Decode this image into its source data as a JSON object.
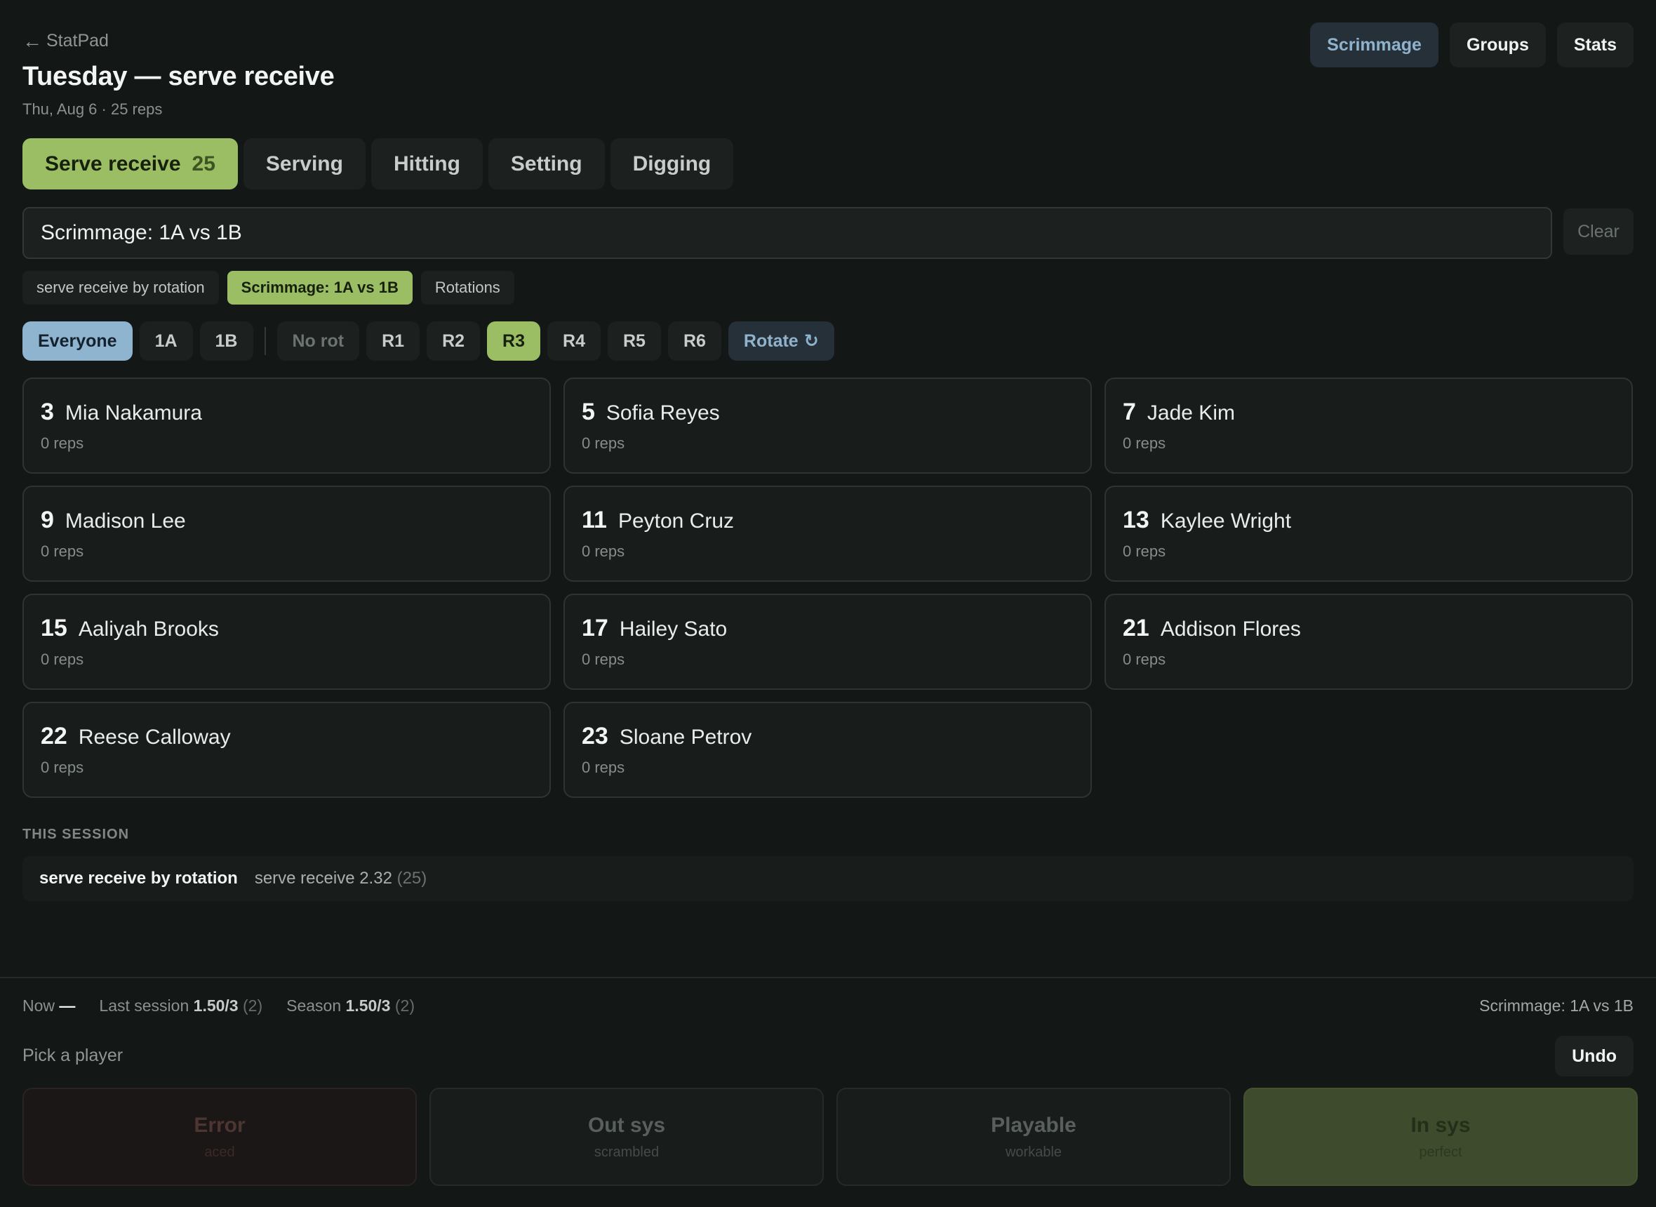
{
  "header": {
    "back_arrow": "←",
    "back_label": "StatPad",
    "title": "Tuesday — serve receive",
    "subtitle": "Thu, Aug 6 · 25 reps"
  },
  "topnav": [
    "Scrimmage",
    "Groups",
    "Stats"
  ],
  "skills": [
    {
      "label": "Serve receive",
      "count": "25"
    },
    {
      "label": "Serving",
      "count": ""
    },
    {
      "label": "Hitting",
      "count": ""
    },
    {
      "label": "Setting",
      "count": ""
    },
    {
      "label": "Digging",
      "count": ""
    }
  ],
  "search": {
    "value": "Scrimmage: 1A vs 1B",
    "clear_label": "Clear"
  },
  "chips": [
    "serve receive by rotation",
    "Scrimmage: 1A vs 1B",
    "Rotations"
  ],
  "filters": {
    "groups": [
      "Everyone",
      "1A",
      "1B"
    ],
    "rotations": [
      "No rot",
      "R1",
      "R2",
      "R3",
      "R4",
      "R5",
      "R6"
    ],
    "rotate_label": "Rotate",
    "rotate_icon": "↻"
  },
  "players": [
    {
      "num": "3",
      "name": "Mia Nakamura",
      "reps": "0 reps"
    },
    {
      "num": "5",
      "name": "Sofia Reyes",
      "reps": "0 reps"
    },
    {
      "num": "7",
      "name": "Jade Kim",
      "reps": "0 reps"
    },
    {
      "num": "9",
      "name": "Madison Lee",
      "reps": "0 reps"
    },
    {
      "num": "11",
      "name": "Peyton Cruz",
      "reps": "0 reps"
    },
    {
      "num": "13",
      "name": "Kaylee Wright",
      "reps": "0 reps"
    },
    {
      "num": "15",
      "name": "Aaliyah Brooks",
      "reps": "0 reps"
    },
    {
      "num": "17",
      "name": "Hailey Sato",
      "reps": "0 reps"
    },
    {
      "num": "21",
      "name": "Addison Flores",
      "reps": "0 reps"
    },
    {
      "num": "22",
      "name": "Reese Calloway",
      "reps": "0 reps"
    },
    {
      "num": "23",
      "name": "Sloane Petrov",
      "reps": "0 reps"
    }
  ],
  "session": {
    "label": "THIS SESSION",
    "name": "serve receive by rotation",
    "value": "serve receive 2.32",
    "count": "(25)"
  },
  "bottom": {
    "now_label": "Now",
    "now_value": "—",
    "last_label": "Last session",
    "last_value": "1.50/3",
    "last_count": "(2)",
    "season_label": "Season",
    "season_value": "1.50/3",
    "season_count": "(2)",
    "scope": "Scrimmage: 1A vs 1B",
    "pick": "Pick a player",
    "undo": "Undo"
  },
  "grades": [
    {
      "title": "Error",
      "sub": "aced"
    },
    {
      "title": "Out sys",
      "sub": "scrambled"
    },
    {
      "title": "Playable",
      "sub": "workable"
    },
    {
      "title": "In sys",
      "sub": "perfect"
    }
  ],
  "colors": {
    "background": "#131716",
    "accent_green": "#9bbd64",
    "accent_blue": "#8fb4d0"
  }
}
